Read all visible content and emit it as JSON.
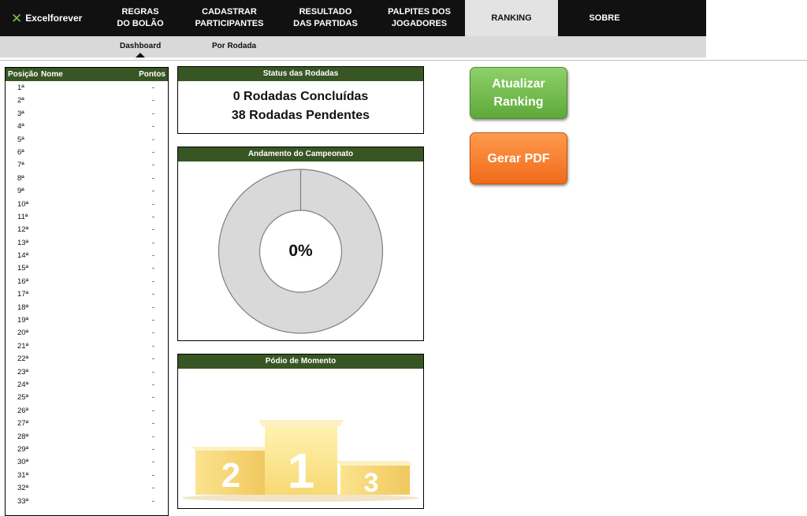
{
  "brand": {
    "name": "Excelforever",
    "accent": "#7dc142"
  },
  "nav": {
    "items": [
      {
        "label": "REGRAS\nDO BOLÃO"
      },
      {
        "label": "CADASTRAR\nPARTICIPANTES"
      },
      {
        "label": "RESULTADO\nDAS PARTIDAS"
      },
      {
        "label": "PALPITES DOS\nJOGADORES"
      },
      {
        "label": "RANKING",
        "active": true
      },
      {
        "label": "SOBRE"
      }
    ]
  },
  "subnav": {
    "items": [
      {
        "label": "Dashboard",
        "active": true
      },
      {
        "label": "Por Rodada"
      }
    ]
  },
  "ranking": {
    "headers": {
      "position": "Posição",
      "name": "Nome",
      "points": "Pontos"
    },
    "rows": [
      {
        "pos": "1ª",
        "pts": "-"
      },
      {
        "pos": "2ª",
        "pts": "-"
      },
      {
        "pos": "3ª",
        "pts": "-"
      },
      {
        "pos": "4ª",
        "pts": "-"
      },
      {
        "pos": "5ª",
        "pts": "-"
      },
      {
        "pos": "6ª",
        "pts": "-"
      },
      {
        "pos": "7ª",
        "pts": "-"
      },
      {
        "pos": "8ª",
        "pts": "-"
      },
      {
        "pos": "9ª",
        "pts": "-"
      },
      {
        "pos": "10ª",
        "pts": "-"
      },
      {
        "pos": "11ª",
        "pts": "-"
      },
      {
        "pos": "12ª",
        "pts": "-"
      },
      {
        "pos": "13ª",
        "pts": "-"
      },
      {
        "pos": "14ª",
        "pts": "-"
      },
      {
        "pos": "15ª",
        "pts": "-"
      },
      {
        "pos": "16ª",
        "pts": "-"
      },
      {
        "pos": "17ª",
        "pts": "-"
      },
      {
        "pos": "18ª",
        "pts": "-"
      },
      {
        "pos": "19ª",
        "pts": "-"
      },
      {
        "pos": "20ª",
        "pts": "-"
      },
      {
        "pos": "21ª",
        "pts": "-"
      },
      {
        "pos": "22ª",
        "pts": "-"
      },
      {
        "pos": "23ª",
        "pts": "-"
      },
      {
        "pos": "24ª",
        "pts": "-"
      },
      {
        "pos": "25ª",
        "pts": "-"
      },
      {
        "pos": "26ª",
        "pts": "-"
      },
      {
        "pos": "27ª",
        "pts": "-"
      },
      {
        "pos": "28ª",
        "pts": "-"
      },
      {
        "pos": "29ª",
        "pts": "-"
      },
      {
        "pos": "30ª",
        "pts": "-"
      },
      {
        "pos": "31ª",
        "pts": "-"
      },
      {
        "pos": "32ª",
        "pts": "-"
      },
      {
        "pos": "33ª",
        "pts": "-"
      }
    ]
  },
  "status": {
    "title": "Status das Rodadas",
    "concluded": "0 Rodadas Concluídas",
    "pending": "38 Rodadas Pendentes"
  },
  "progress": {
    "title": "Andamento do Campeonato",
    "label": "0%",
    "fraction": 0.0,
    "track_color": "#d9d9d9"
  },
  "podium": {
    "title": "Pódio de Momento",
    "places": [
      "1",
      "2",
      "3"
    ]
  },
  "buttons": {
    "update": {
      "label": "Atualizar\nRanking",
      "color": "#6cbd45"
    },
    "pdf": {
      "label": "Gerar PDF",
      "color": "#f57c28"
    }
  },
  "colors": {
    "header_green": "#375623",
    "topbar": "#111111"
  }
}
